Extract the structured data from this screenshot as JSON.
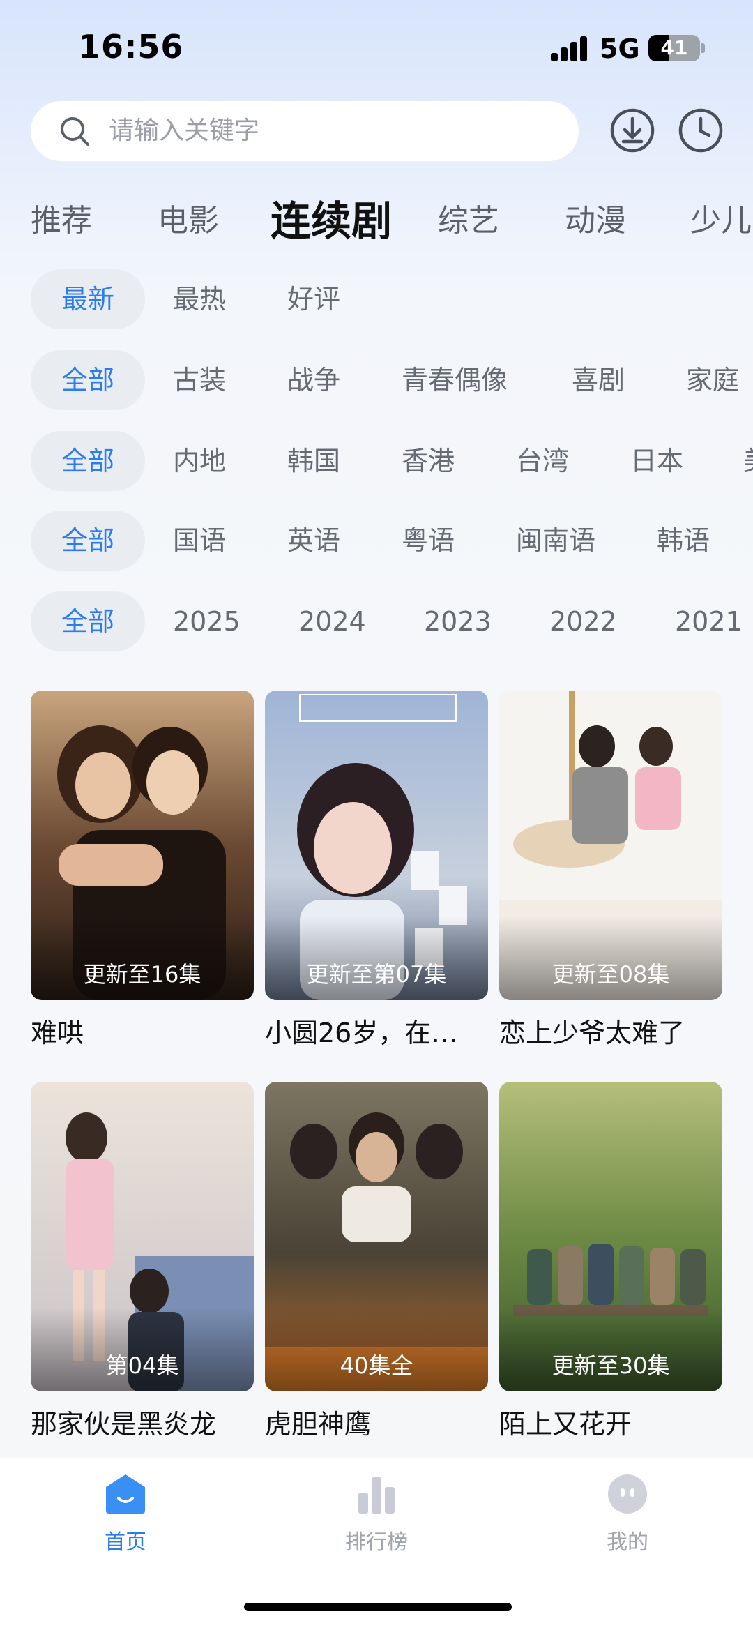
{
  "status_bar": {
    "time": "16:56",
    "network": "5G",
    "battery": "41",
    "battery_level": 0.41
  },
  "search": {
    "placeholder": "请输入关键字",
    "icons": [
      "search-icon",
      "download-icon",
      "history-icon"
    ]
  },
  "category_tabs": [
    {
      "label": "推荐",
      "active": false
    },
    {
      "label": "电影",
      "active": false
    },
    {
      "label": "连续剧",
      "active": true
    },
    {
      "label": "综艺",
      "active": false
    },
    {
      "label": "动漫",
      "active": false
    },
    {
      "label": "少儿",
      "active": false
    }
  ],
  "filters": {
    "sort": [
      "最新",
      "最热",
      "好评"
    ],
    "genre": [
      "全部",
      "古装",
      "战争",
      "青春偶像",
      "喜剧",
      "家庭"
    ],
    "region": [
      "全部",
      "内地",
      "韩国",
      "香港",
      "台湾",
      "日本",
      "美"
    ],
    "language": [
      "全部",
      "国语",
      "英语",
      "粤语",
      "闽南语",
      "韩语"
    ],
    "year": [
      "全部",
      "2025",
      "2024",
      "2023",
      "2022",
      "2021"
    ]
  },
  "shows": [
    {
      "title": "难哄",
      "badge": "更新至16集"
    },
    {
      "title": "小圆26岁，在…",
      "badge": "更新至第07集"
    },
    {
      "title": "恋上少爷太难了",
      "badge": "更新至08集"
    },
    {
      "title": "那家伙是黑炎龙",
      "badge": "第04集"
    },
    {
      "title": "虎胆神鹰",
      "badge": "40集全"
    },
    {
      "title": "陌上又花开",
      "badge": "更新至30集"
    }
  ],
  "bottom_nav": [
    {
      "label": "首页",
      "icon": "home-icon",
      "active": true
    },
    {
      "label": "排行榜",
      "icon": "ranking-icon",
      "active": false
    },
    {
      "label": "我的",
      "icon": "profile-icon",
      "active": false
    }
  ],
  "colors": {
    "accent": "#2a7cf0",
    "chip_bg": "#e9edf2",
    "inactive_text": "#666b73"
  }
}
